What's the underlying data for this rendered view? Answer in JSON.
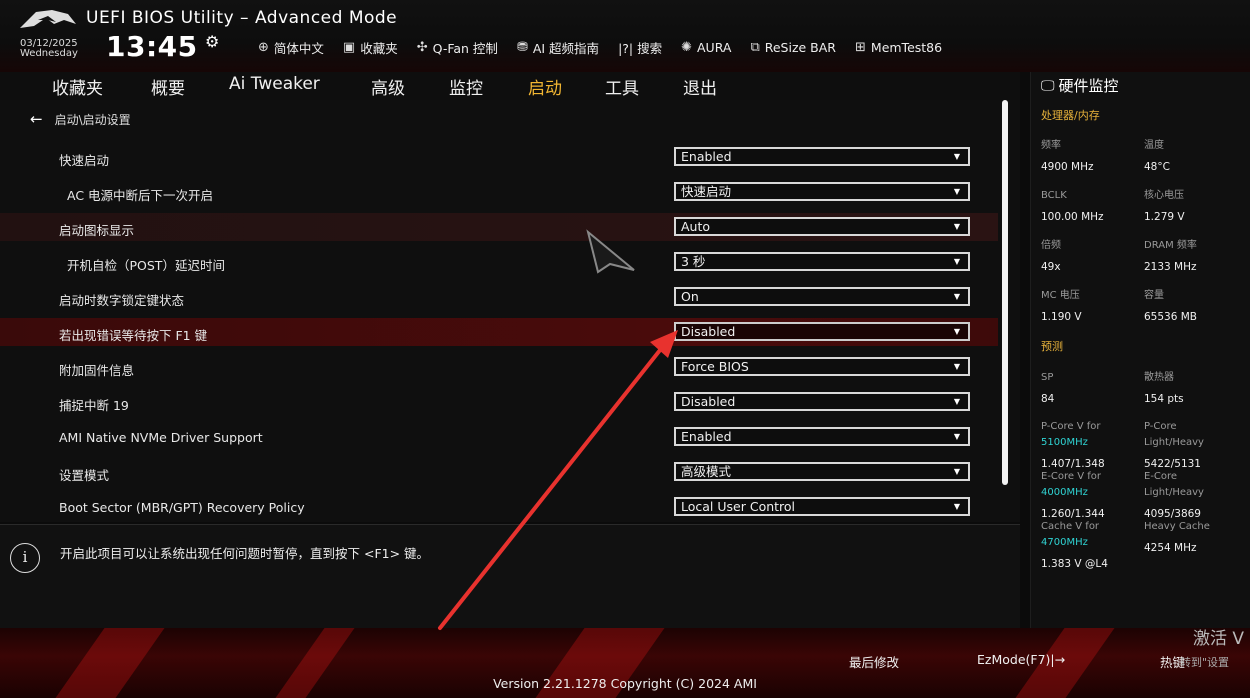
{
  "app": {
    "title": "UEFI BIOS Utility – Advanced Mode",
    "date": "03/12/2025",
    "weekday": "Wednesday",
    "time": "13:45"
  },
  "toolbar": [
    {
      "icon": "globe-icon",
      "label": "简体中文"
    },
    {
      "icon": "favorites-icon",
      "label": "收藏夹"
    },
    {
      "icon": "fan-icon",
      "label": "Q-Fan 控制"
    },
    {
      "icon": "ai-icon",
      "label": "AI 超频指南"
    },
    {
      "icon": "help-search-icon",
      "label": "|?| 搜索"
    },
    {
      "icon": "aura-icon",
      "label": "AURA"
    },
    {
      "icon": "resize-bar-icon",
      "label": "ReSize BAR"
    },
    {
      "icon": "memtest-icon",
      "label": "MemTest86"
    }
  ],
  "tabs": [
    {
      "label": "收藏夹",
      "active": false
    },
    {
      "label": "概要",
      "active": false
    },
    {
      "label": "Ai Tweaker",
      "active": false
    },
    {
      "label": "高级",
      "active": false
    },
    {
      "label": "监控",
      "active": false
    },
    {
      "label": "启动",
      "active": true
    },
    {
      "label": "工具",
      "active": false
    },
    {
      "label": "退出",
      "active": false
    }
  ],
  "breadcrumb": "启动\\启动设置",
  "settings": [
    {
      "label": "快速启动",
      "value": "Enabled",
      "indent": false,
      "state": "normal"
    },
    {
      "label": "AC 电源中断后下一次开启",
      "value": "快速启动",
      "indent": true,
      "state": "normal"
    },
    {
      "label": "启动图标显示",
      "value": "Auto",
      "indent": false,
      "state": "dim"
    },
    {
      "label": "开机自检（POST）延迟时间",
      "value": "3 秒",
      "indent": true,
      "state": "normal"
    },
    {
      "label": "启动时数字锁定键状态",
      "value": "On",
      "indent": false,
      "state": "normal"
    },
    {
      "label": "若出现错误等待按下 F1 键",
      "value": "Disabled",
      "indent": false,
      "state": "selected"
    },
    {
      "label": "附加固件信息",
      "value": "Force BIOS",
      "indent": false,
      "state": "normal"
    },
    {
      "label": "捕捉中断 19",
      "value": "Disabled",
      "indent": false,
      "state": "normal"
    },
    {
      "label": "AMI Native NVMe Driver Support",
      "value": "Enabled",
      "indent": false,
      "state": "normal"
    },
    {
      "label": "设置模式",
      "value": "高级模式",
      "indent": false,
      "state": "normal"
    },
    {
      "label": "Boot Sector (MBR/GPT) Recovery Policy",
      "value": "Local User Control",
      "indent": false,
      "state": "normal"
    }
  ],
  "info": {
    "icon": "info-icon",
    "text": "开启此项目可以让系统出现任何问题时暂停，直到按下 <F1> 键。"
  },
  "hw": {
    "title": "硬件监控",
    "sections": {
      "cpu_mem": "处理器/内存",
      "prediction": "预测"
    },
    "cpu": [
      {
        "k1": "频率",
        "v1": "4900 MHz",
        "k2": "温度",
        "v2": "48°C"
      },
      {
        "k1": "BCLK",
        "v1": "100.00 MHz",
        "k2": "核心电压",
        "v2": "1.279 V"
      },
      {
        "k1": "倍频",
        "v1": "49x",
        "k2": "DRAM 频率",
        "v2": "2133 MHz"
      },
      {
        "k1": "MC 电压",
        "v1": "1.190 V",
        "k2": "容量",
        "v2": "65536 MB"
      }
    ],
    "pred": {
      "sp_k": "SP",
      "sp_v": "84",
      "cooler_k": "散热器",
      "cooler_v": "154 pts",
      "pcore_k1": "P-Core V for",
      "pcore_freq": "5100MHz",
      "pcore_v": "1.407/1.348",
      "pcore_k2a": "P-Core",
      "pcore_k2b": "Light/Heavy",
      "pcore_lh": "5422/5131",
      "ecore_k1": "E-Core V for",
      "ecore_freq": "4000MHz",
      "ecore_v": "1.260/1.344",
      "ecore_k2a": "E-Core",
      "ecore_k2b": "Light/Heavy",
      "ecore_lh": "4095/3869",
      "cache_k1": "Cache V for",
      "cache_freq": "4700MHz",
      "cache_v": "1.383 V @L4",
      "cache_k2": "Heavy Cache",
      "cache_hv": "4254 MHz"
    }
  },
  "footer": {
    "last_modified": "最后修改",
    "ezmode": "EzMode(F7)|→",
    "hotkeys": "热键",
    "version": "Version 2.21.1278 Copyright (C) 2024 AMI",
    "watermark": "激活 V",
    "watermark2": "转到\"设置"
  }
}
